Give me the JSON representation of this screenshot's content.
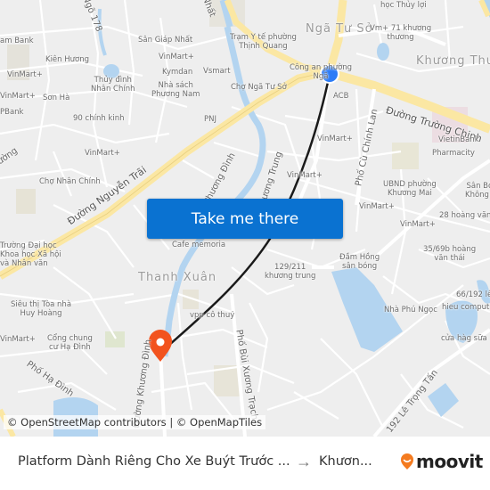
{
  "map": {
    "labels": {
      "ngo178": "Ngõ 178",
      "nhat": "Nhất",
      "am_bank": "am Bank",
      "san_giap_nhat": "Sân Giáp Nhất",
      "tram_y_te": "Trạm Y tế phường\nThịnh Quang",
      "nga_tu_so_district": "Ngã Tư Sở",
      "vm71": "Vm+ 71 khương\nthương",
      "hoc_thuy_loi": "học Thủy lợi",
      "khuong_thuong": "Khương Thư",
      "kien_huong": "Kiên Hương",
      "vinmart_1": "VinMart+",
      "kymdan": "Kymdan",
      "vsmart": "Vsmart",
      "vinmart_2": "VinMart+",
      "thuy_dinh": "Thủy đình\nNhân Chính",
      "nha_sach": "Nhà sách\nPhương Nam",
      "cho_nga_tu_so": "Chợ Ngã Tư Sở",
      "cong_an": "Công an phường\nNgã",
      "vinmart_3": "VinMart+",
      "son_ha": "Sơn Hà",
      "pbank": "PBank",
      "acb": "ACB",
      "duong_truong_chinh": "Đường Trường Chinh",
      "chinh_kinh": "90 chính kinh",
      "pnj": "PNJ",
      "pho_cu_chinh_lan": "Phố Cù Chính Lan",
      "vietinbank": "VietinBank",
      "pharmacity": "Pharmacity",
      "duong_left": "ường",
      "vinmart_4": "VinMart+",
      "vinmart_5": "VinMart+",
      "vinmart_6": "VinMart+",
      "cho_nhan_chinh": "Chợ Nhân Chính",
      "duong_nguyen_trai": "Đường Nguyễn Trãi",
      "khuong_dinh_1": "Phương Đình",
      "khuong_trung": "Phố Khương Trung",
      "ubnd": "UBND phường\nKhương Mai",
      "san_bong": "Sân Bó\nKhông -",
      "hoang_van": "28 hoàng văn",
      "vinmart_7": "VinMart+",
      "vinmart_8": "VinMart+",
      "vinmart_9": "VinMart+",
      "dai_hoc": "Trường Đại học\nKhoa học Xã hội\nvà Nhân văn",
      "cafe": "Cafe memoria",
      "hoang_van_thai": "35/69b hoàng\nvăn thái",
      "dam_hong": "Đầm Hồng\nsân bóng",
      "khuong_trung_129": "129/211\nkhương trung",
      "thanh_xuan": "Thanh Xuân",
      "sieu_thi": "Siêu thị Tòa nhà\nHuy Hoàng",
      "lek": "66/192 lê",
      "hieu_computer": "hieu compute",
      "nha_phu_ngoc": "Nhà Phú Ngọc",
      "vpp_co_thuy": "vpp cô thuỷ",
      "vinmart_10": "VinMart+",
      "cong_chung": "Cổng chung\ncư Hạ Đình",
      "cua_hang_sua": "cửa hàg sữa",
      "pho_ha_dinh": "Phố Hạ Đình",
      "duong_khuong_dinh": "Đường Khương Đình",
      "pho_bui_xuong": "Phố Bùi Xương Trạch",
      "le_trong_tan": "192 Lê Trọng Tấn"
    },
    "origin_marker_color": "#2d7cf6",
    "destination_marker_color": "#f2531e",
    "route_color": "#1a1a1a",
    "cta_label": "Take me there",
    "attribution": "© OpenStreetMap contributors | © OpenMapTiles"
  },
  "footer": {
    "origin": "Platform Dành Riêng Cho Xe Buýt Trước ...",
    "arrow": "→",
    "destination": "Khươn...",
    "brand": "moovit",
    "brand_color": "#f47b20"
  }
}
